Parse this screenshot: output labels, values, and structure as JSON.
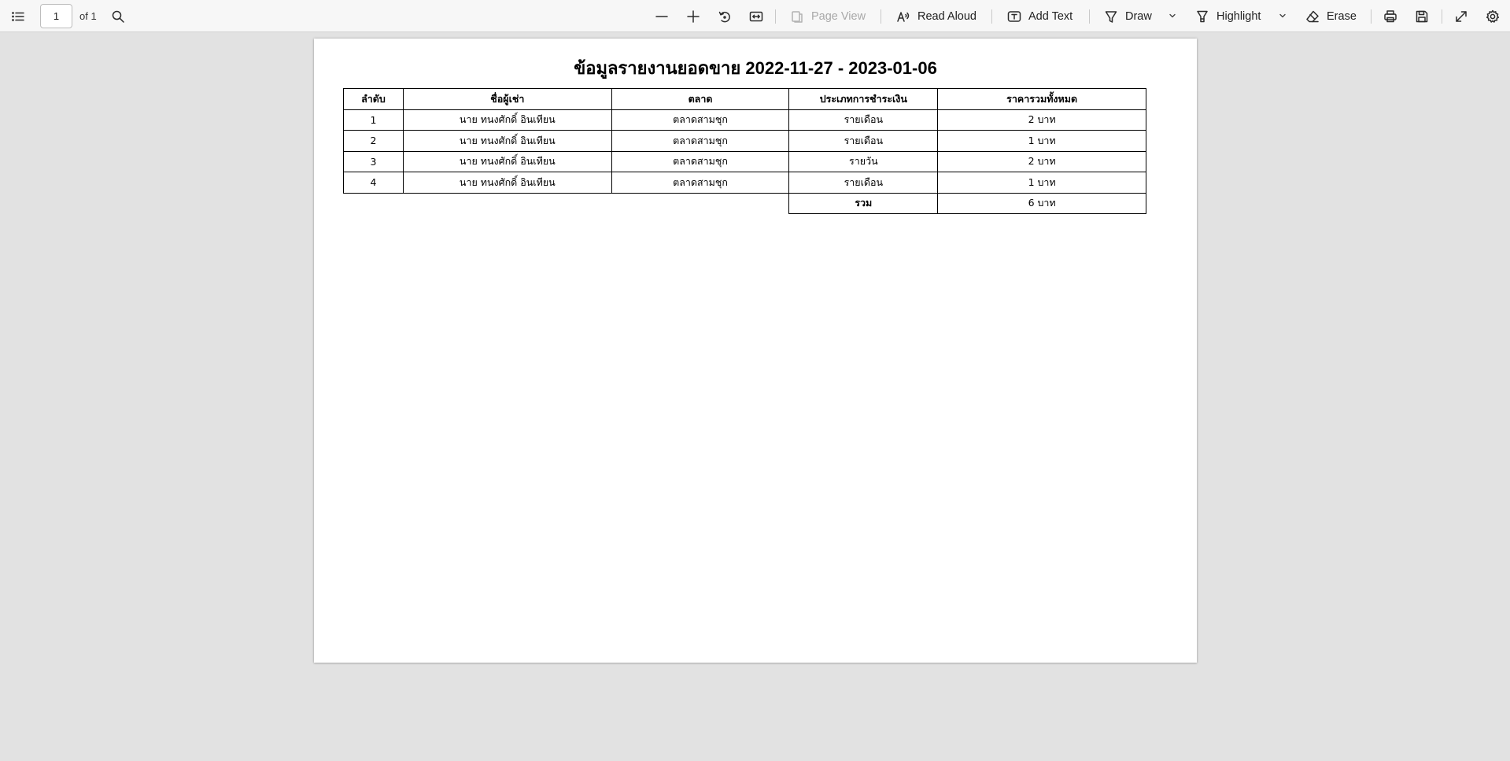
{
  "toolbar": {
    "current_page": "1",
    "page_total": "of 1",
    "page_view_label": "Page View",
    "read_aloud_label": "Read Aloud",
    "add_text_label": "Add Text",
    "draw_label": "Draw",
    "highlight_label": "Highlight",
    "erase_label": "Erase"
  },
  "document": {
    "title": "ข้อมูลรายงานยอดขาย 2022-11-27 - 2023-01-06",
    "table": {
      "headers": [
        "ลำดับ",
        "ชื่อผู้เช่า",
        "ตลาด",
        "ประเภทการชำระเงิน",
        "ราคารวมทั้งหมด"
      ],
      "rows": [
        [
          "1",
          "นาย ทนงศักดิ์ อินเทียน",
          "ตลาดสามชุก",
          "รายเดือน",
          "2 บาท"
        ],
        [
          "2",
          "นาย ทนงศักดิ์ อินเทียน",
          "ตลาดสามชุก",
          "รายเดือน",
          "1 บาท"
        ],
        [
          "3",
          "นาย ทนงศักดิ์ อินเทียน",
          "ตลาดสามชุก",
          "รายวัน",
          "2 บาท"
        ],
        [
          "4",
          "นาย ทนงศักดิ์ อินเทียน",
          "ตลาดสามชุก",
          "รายเดือน",
          "1 บาท"
        ]
      ],
      "total_label": "รวม",
      "total_value": "6 บาท"
    }
  }
}
